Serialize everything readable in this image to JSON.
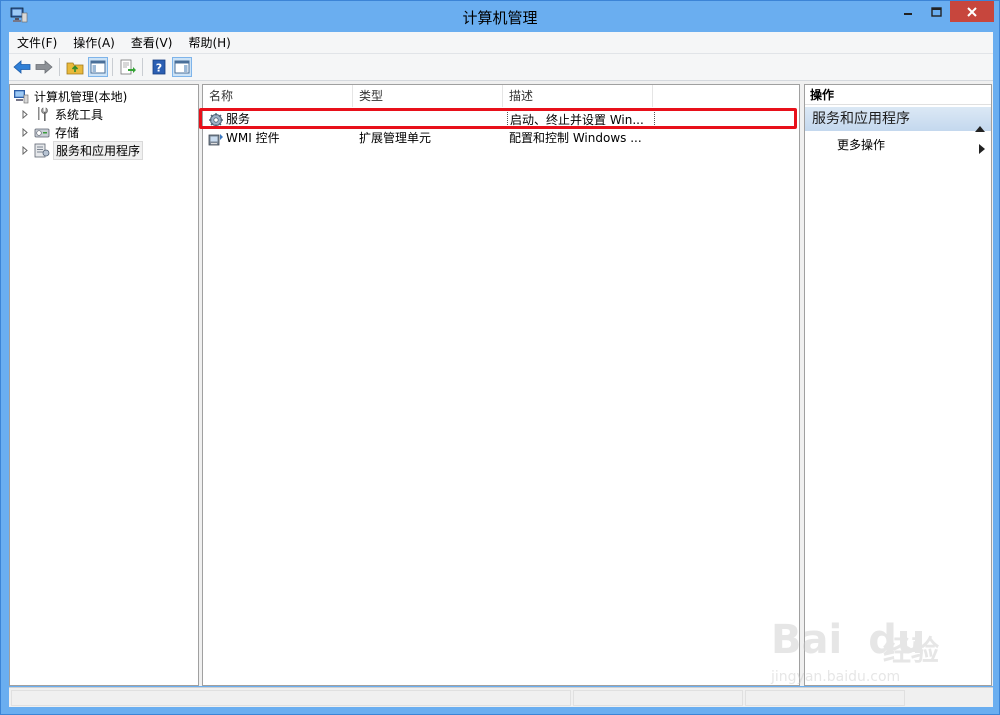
{
  "window": {
    "title": "计算机管理",
    "colors": {
      "frame": "#6aaef0",
      "close": "#c7463d",
      "highlight": "#e8101a"
    }
  },
  "menu": {
    "items": [
      {
        "label": "文件(F)"
      },
      {
        "label": "操作(A)"
      },
      {
        "label": "查看(V)"
      },
      {
        "label": "帮助(H)"
      }
    ]
  },
  "toolbar": {
    "buttons": [
      "back-icon",
      "forward-icon",
      "up-folder-icon",
      "show-tree-icon",
      "export-icon",
      "help-icon",
      "show-action-pane-icon"
    ]
  },
  "tree": {
    "root": "计算机管理(本地)",
    "items": [
      {
        "label": "系统工具",
        "icon": "tools-icon"
      },
      {
        "label": "存储",
        "icon": "storage-icon"
      },
      {
        "label": "服务和应用程序",
        "icon": "services-apps-icon",
        "selected": true
      }
    ]
  },
  "list": {
    "columns": [
      "名称",
      "类型",
      "描述"
    ],
    "rows": [
      {
        "name": "服务",
        "type": "",
        "desc": "启动、终止并设置 Win...",
        "icon": "services-gear-icon"
      },
      {
        "name": "WMI 控件",
        "type": "扩展管理单元",
        "desc": "配置和控制 Windows ...",
        "icon": "wmi-control-icon"
      }
    ]
  },
  "actions": {
    "header": "操作",
    "group": "服务和应用程序",
    "more": "更多操作"
  },
  "watermark": {
    "brand_latin": "Bai",
    "brand_latin2": "du",
    "brand_cn": "经验",
    "url": "jingyan.baidu.com"
  }
}
